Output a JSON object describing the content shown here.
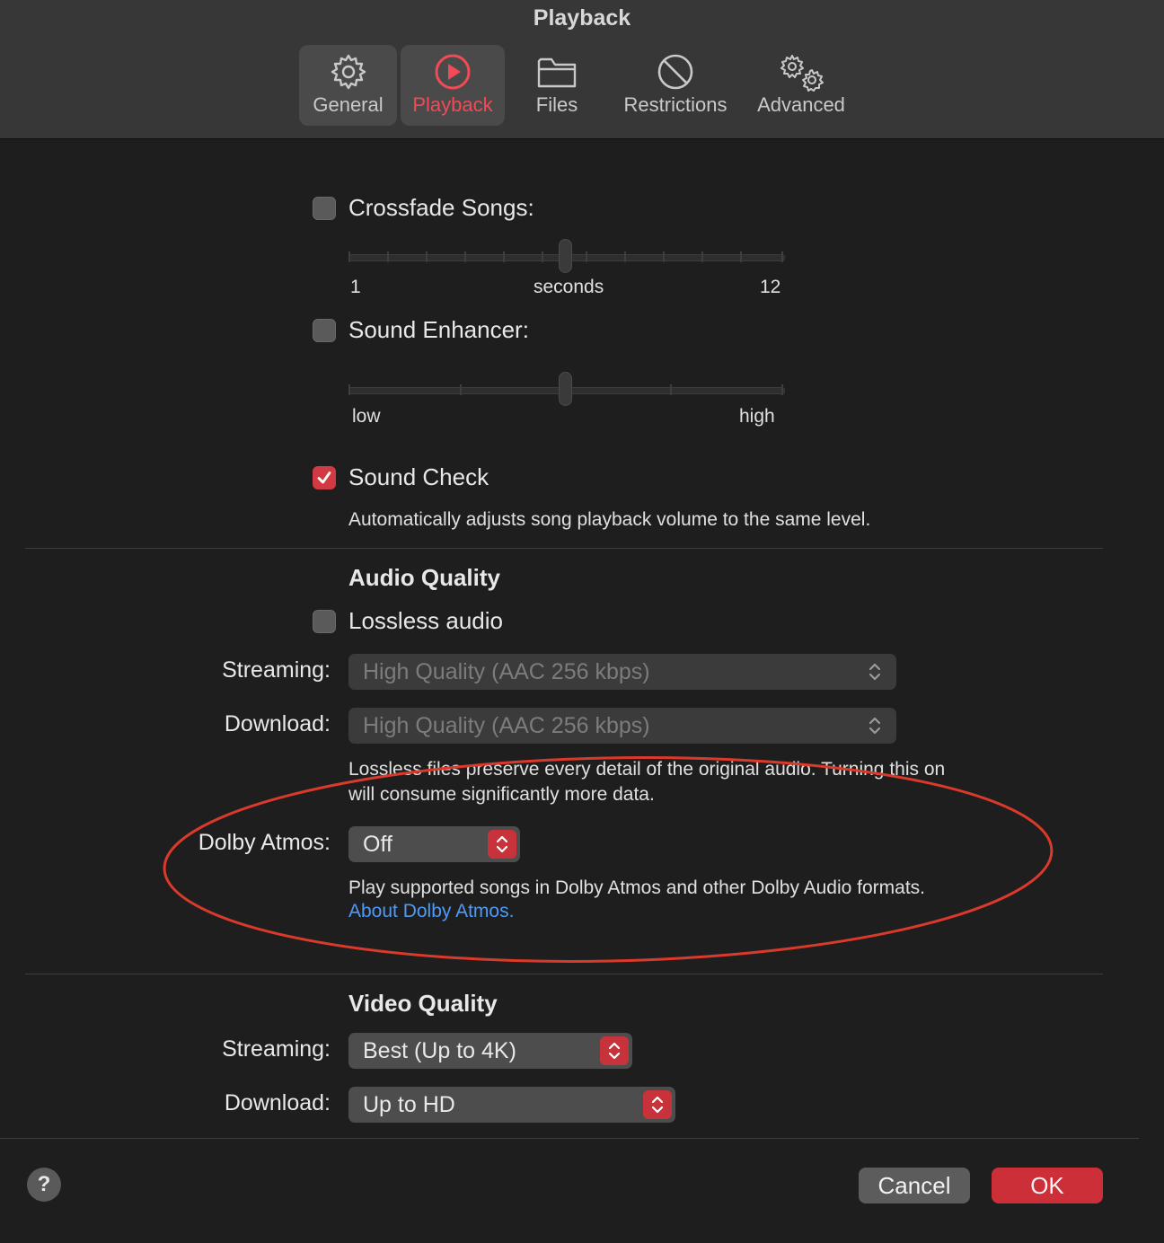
{
  "window": {
    "title": "Playback"
  },
  "tabs": [
    {
      "label": "General",
      "icon": "gear-icon"
    },
    {
      "label": "Playback",
      "icon": "play-circle-icon",
      "active": true
    },
    {
      "label": "Files",
      "icon": "folder-icon"
    },
    {
      "label": "Restrictions",
      "icon": "prohibited-icon"
    },
    {
      "label": "Advanced",
      "icon": "gears-icon"
    }
  ],
  "crossfade": {
    "label": "Crossfade Songs:",
    "checked": false,
    "min_label": "1",
    "mid_label": "seconds",
    "max_label": "12"
  },
  "enhancer": {
    "label": "Sound Enhancer:",
    "checked": false,
    "min_label": "low",
    "max_label": "high"
  },
  "sound_check": {
    "label": "Sound Check",
    "checked": true,
    "description": "Automatically adjusts song playback volume to the same level."
  },
  "audio_quality": {
    "heading": "Audio Quality",
    "lossless_label": "Lossless audio",
    "lossless_checked": false,
    "streaming_label": "Streaming:",
    "streaming_value": "High Quality (AAC 256 kbps)",
    "download_label": "Download:",
    "download_value": "High Quality (AAC 256 kbps)",
    "lossless_note_line1": "Lossless files preserve every detail of the original audio. Turning this on",
    "lossless_note_line2": "will consume significantly more data.",
    "dolby_label": "Dolby Atmos:",
    "dolby_value": "Off",
    "dolby_description": "Play supported songs in Dolby Atmos and other Dolby Audio formats.",
    "dolby_link": "About Dolby Atmos."
  },
  "video_quality": {
    "heading": "Video Quality",
    "streaming_label": "Streaming:",
    "streaming_value": "Best (Up to 4K)",
    "download_label": "Download:",
    "download_value": "Up to HD"
  },
  "footer": {
    "help": "?",
    "cancel": "Cancel",
    "ok": "OK"
  },
  "colors": {
    "accent": "#d13a43",
    "annotation": "#d93a2b",
    "link": "#4d9bf7"
  }
}
